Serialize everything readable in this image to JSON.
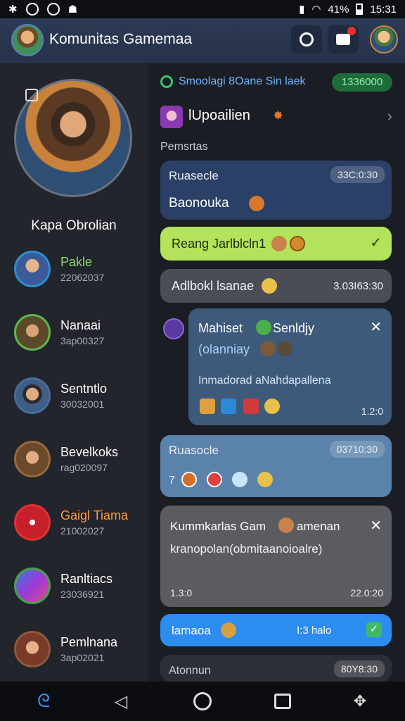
{
  "status_bar": {
    "battery_percent": "41%",
    "time": "15:31"
  },
  "header": {
    "title": "Komunitas Gamemaa"
  },
  "sidebar": {
    "profile_name": "Kapa Obrolian",
    "contacts": [
      {
        "name": "Pakle",
        "number": "22062037",
        "color": "#8fd66b"
      },
      {
        "name": "Nanaai",
        "number": "3ap00327",
        "color": "#ffffff"
      },
      {
        "name": "Sentntlo",
        "number": "30032001",
        "color": "#ffffff"
      },
      {
        "name": "Bevelkoks",
        "number": "rag020097",
        "color": "#ffffff"
      },
      {
        "name": "Gaigl Tiama",
        "number": "21002027",
        "color": "#ff9a3c"
      },
      {
        "name": "Ranltiacs",
        "number": "23036921",
        "color": "#ffffff"
      },
      {
        "name": "Pemlnana",
        "number": "3ap02021",
        "color": "#ffffff"
      }
    ]
  },
  "main": {
    "banner": {
      "text": "Smoolagi 8Oane Sin laek",
      "count": "1336000"
    },
    "channel": {
      "name": "lUpoailien"
    },
    "section_label": "Pemsrtas",
    "messages": [
      {
        "name": "Ruasecle",
        "time": "33C:0:30",
        "text": "Baonouka"
      },
      {
        "text": "Reang Jarlblcln1"
      },
      {
        "text": "Adlbokl lsanae",
        "time": "3.03I63:30"
      },
      {
        "title": "Mahiset",
        "title2": "Senldjy",
        "subtitle": "(olanniay",
        "body": "Inmadorad aNahdapallena",
        "time": "1.2:0"
      },
      {
        "name": "Ruasocle",
        "time": "03710:30",
        "lead": "7"
      },
      {
        "title": "Kummkarlas Gam",
        "title2": "amenan",
        "body": "kranopolan(obmitaanoioalre)",
        "time_left": "1.3:0",
        "time_right": "22.0:20"
      },
      {
        "text": "lamaoa",
        "sub": "I:3 halo"
      },
      {
        "name": "Atonnun",
        "time": "80Y8:30"
      }
    ]
  },
  "colors": {
    "accent_green": "#b3e35a",
    "accent_blue": "#2d8cf0",
    "bubble_navy": "#2a4066",
    "bubble_steel": "#3d5a7a"
  }
}
